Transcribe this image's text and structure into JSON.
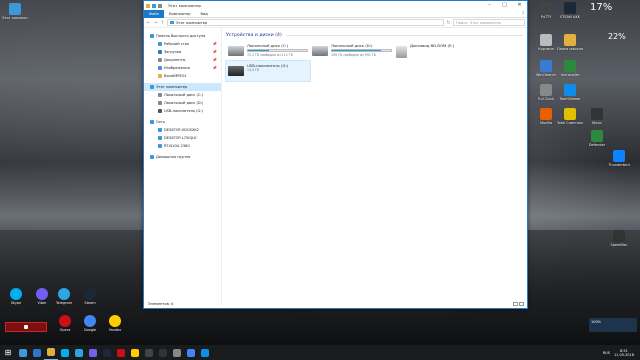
{
  "desktop_left": [
    {
      "name": "icon-this-pc",
      "label": "Этот компьютер",
      "color": "#3a9ad9"
    }
  ],
  "desktop_bottom": [
    {
      "label": "Skype",
      "color": "#00aff0"
    },
    {
      "label": "Viber",
      "color": "#7360f2"
    },
    {
      "label": "Telegram",
      "color": "#2ca5e0"
    },
    {
      "label": "Steam",
      "color": "#1b2838"
    },
    {
      "label": "Opera",
      "color": "#cc0f16"
    },
    {
      "label": "Google",
      "color": "#4285f4"
    },
    {
      "label": "Yandex",
      "color": "#ffcc00"
    }
  ],
  "desktop_right": [
    {
      "label": "PuTTY",
      "color": "#444"
    },
    {
      "label": "STEAM AKK",
      "color": "#1b2838"
    },
    {
      "label": "Корзина",
      "color": "#bbb"
    },
    {
      "label": "Папка машины",
      "color": "#e0b040"
    },
    {
      "label": "WinCleaner",
      "color": "#3a7bd5"
    },
    {
      "label": "Uninstaller",
      "color": "#2b8a3e"
    },
    {
      "label": "Full Clock",
      "color": "#888"
    },
    {
      "label": "TeamViewer",
      "color": "#0e8ee9"
    },
    {
      "label": "Total Commander",
      "color": "#e0c000"
    },
    {
      "label": "Music",
      "color": "#333"
    },
    {
      "label": "Mozilla",
      "color": "#e66000"
    },
    {
      "label": "Defender",
      "color": "#2b8a3e"
    },
    {
      "label": "Thunderbird",
      "color": "#0a84ff"
    },
    {
      "label": "SpeedFan",
      "color": "#333"
    }
  ],
  "widgets": {
    "cpu": "17%",
    "mem": "22%",
    "volume_label": "100%"
  },
  "window": {
    "title": "Этот компьютер",
    "tabs": {
      "file": "Файл",
      "computer": "Компьютер",
      "view": "Вид"
    },
    "address": "Этот компьютер",
    "search_placeholder": "Поиск: Этот компьютер",
    "nav": [
      {
        "label": "Панель быстрого доступа",
        "sub": false,
        "color": "#3a9ad9"
      },
      {
        "label": "Рабочий стол",
        "sub": true,
        "pin": true,
        "color": "#3a9ad9"
      },
      {
        "label": "Загрузки",
        "sub": true,
        "pin": true,
        "color": "#2b78c8"
      },
      {
        "label": "Документы",
        "sub": true,
        "pin": true,
        "color": "#888"
      },
      {
        "label": "Изображения",
        "sub": true,
        "pin": true,
        "color": "#3a9ad9"
      },
      {
        "label": "BandiMPEG1",
        "sub": true,
        "pin": false,
        "color": "#e0b040"
      },
      {
        "label": "Этот компьютер",
        "sub": false,
        "sel": true,
        "color": "#3a9ad9"
      },
      {
        "label": "Локальный диск (C:)",
        "sub": true,
        "color": "#888"
      },
      {
        "label": "Локальный диск (D:)",
        "sub": true,
        "color": "#888"
      },
      {
        "label": "USB-накопитель (G:)",
        "sub": true,
        "color": "#555"
      },
      {
        "label": "Сеть",
        "sub": false,
        "color": "#3a9ad9"
      },
      {
        "label": "DESKTOP-0DOSXK2",
        "sub": true,
        "color": "#3a9ad9"
      },
      {
        "label": "DESKTOP-L75IQLK",
        "sub": true,
        "color": "#3a9ad9"
      },
      {
        "label": "RT-N10U-2380",
        "sub": true,
        "color": "#3a9ad9"
      },
      {
        "label": "Домашняя группа",
        "sub": false,
        "color": "#3a9ad9"
      }
    ],
    "group_header": "Устройства и диски (4)",
    "drives": [
      {
        "name": "Локальный диск (C:)",
        "free": "72,2 ГБ свободно из 111 ГБ",
        "used_fraction": 0.35,
        "kind": "hdd",
        "sel": false
      },
      {
        "name": "Локальный диск (D:)",
        "free": "159 ГБ свободно из 931 ГБ",
        "used_fraction": 0.83,
        "kind": "hdd",
        "sel": false
      },
      {
        "name": "Дисковод BD-ROM (E:)",
        "free": "",
        "used_fraction": null,
        "kind": "bd",
        "sel": false
      },
      {
        "name": "USB-накопитель (G:)",
        "free": "14,5 ГБ",
        "used_fraction": null,
        "kind": "usb",
        "sel": true
      }
    ],
    "status": "Элементов: 4"
  },
  "taskbar": {
    "apps": [
      "#3a9ad9",
      "#2b78c8",
      "#e0b040",
      "#00aff0",
      "#2ca5e0",
      "#7360f2",
      "#1b2838",
      "#cc0f16",
      "#ffcc00",
      "#444",
      "#333",
      "#888",
      "#4285f4",
      "#0e8ee9"
    ],
    "lang": "RUS",
    "time": "8:51",
    "date": "11.05.2018"
  }
}
